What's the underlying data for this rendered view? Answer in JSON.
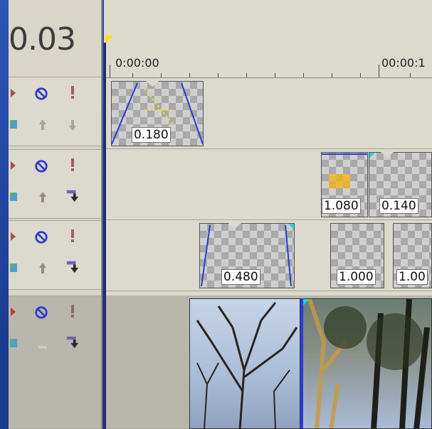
{
  "time_display": {
    "value": "0.03"
  },
  "ruler": {
    "labels": [
      "0:00:00",
      "00:00:1"
    ]
  },
  "clips": {
    "track1": [
      {
        "label": "0.180"
      }
    ],
    "track2": [
      {
        "label": "1.080"
      },
      {
        "label": "0.140"
      }
    ],
    "track3": [
      {
        "label": "0.480"
      },
      {
        "label": "1.000"
      },
      {
        "label": "1.00"
      }
    ]
  },
  "track_headers": [
    {
      "name": "track-1"
    },
    {
      "name": "track-2"
    },
    {
      "name": "track-3"
    },
    {
      "name": "track-4"
    }
  ],
  "icons": {
    "bypass": "bypass-icon",
    "mute": "mute-icon",
    "solo": "solo-icon",
    "composite": "composite-mode-icon",
    "move_up": "move-up-icon",
    "move_down": "move-down-icon"
  },
  "colors": {
    "accent_blue": "#2b3bd6",
    "marker_yellow": "#f5e21a",
    "cyan_handle": "#26d3d3"
  }
}
